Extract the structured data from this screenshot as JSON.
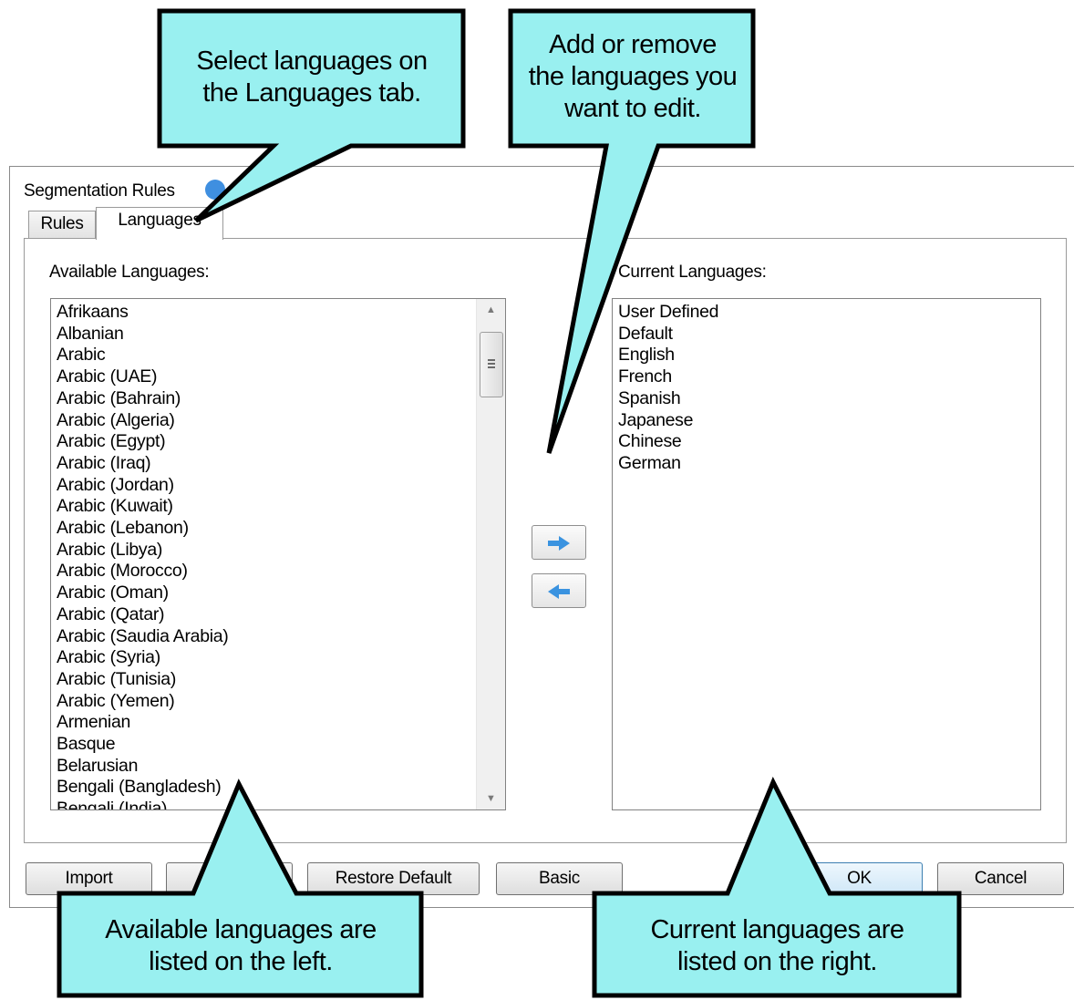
{
  "dialog": {
    "title": "Segmentation Rules",
    "help_icon": "help-icon",
    "tabs": [
      {
        "label": "Rules",
        "selected": false
      },
      {
        "label": "Languages",
        "selected": true
      }
    ],
    "available_label": "Available Languages:",
    "current_label": "Current Languages:",
    "available_languages": [
      "Afrikaans",
      "Albanian",
      "Arabic",
      "Arabic (UAE)",
      "Arabic (Bahrain)",
      "Arabic (Algeria)",
      "Arabic (Egypt)",
      "Arabic (Iraq)",
      "Arabic (Jordan)",
      "Arabic (Kuwait)",
      "Arabic (Lebanon)",
      "Arabic (Libya)",
      "Arabic (Morocco)",
      "Arabic (Oman)",
      "Arabic (Qatar)",
      "Arabic (Saudia Arabia)",
      "Arabic (Syria)",
      "Arabic (Tunisia)",
      "Arabic (Yemen)",
      "Armenian",
      "Basque",
      "Belarusian",
      "Bengali (Bangladesh)",
      "Bengali (India)"
    ],
    "current_languages": [
      "User Defined",
      "Default",
      "English",
      "French",
      "Spanish",
      "Japanese",
      "Chinese",
      "German"
    ],
    "add_button_icon": "arrow-right-icon",
    "remove_button_icon": "arrow-left-icon",
    "buttons": {
      "import": "Import",
      "restore_default": "Restore Default",
      "basic": "Basic",
      "ok": "OK",
      "cancel": "Cancel"
    }
  },
  "callouts": {
    "select_tab": [
      "Select languages on",
      "the Languages tab."
    ],
    "add_remove": [
      "Add or remove",
      "the languages you",
      "want to edit."
    ],
    "available": [
      "Available languages are",
      "listed on the left."
    ],
    "current": [
      "Current languages are",
      "listed on the right."
    ]
  },
  "colors": {
    "callout_fill": "#99f0f0",
    "callout_border": "#000000",
    "arrow_blue": "#3a93e0",
    "ok_border": "#3c7fb1"
  }
}
